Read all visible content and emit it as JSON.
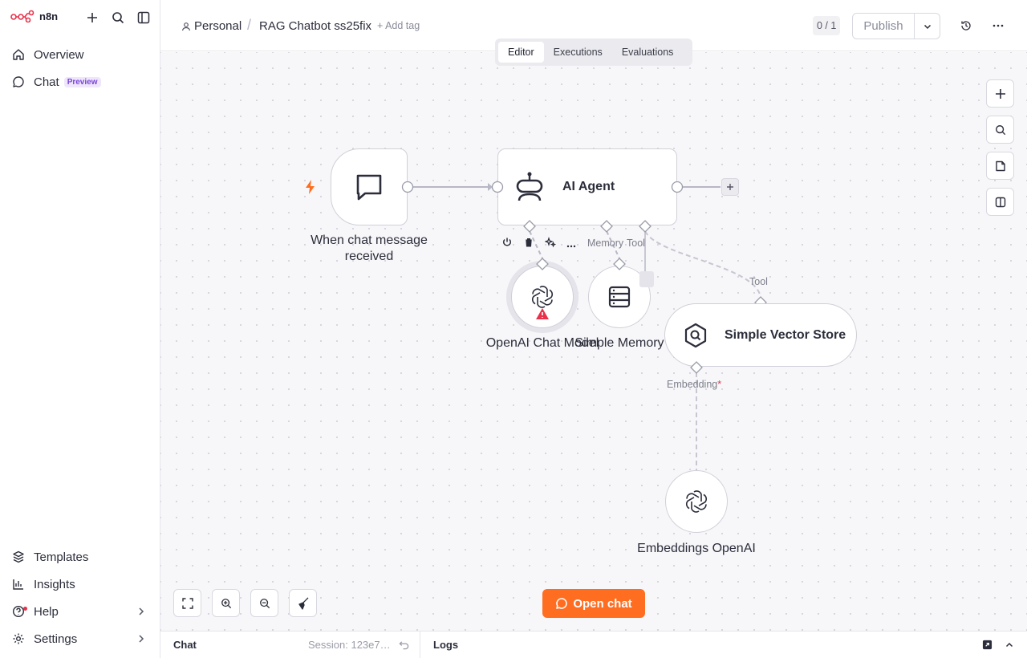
{
  "app": {
    "logo_text": "n8n"
  },
  "sidebar": {
    "top_items": [
      {
        "label": "Overview",
        "icon": "home-icon"
      },
      {
        "label": "Chat",
        "icon": "chat-bubble-icon",
        "badge": "Preview"
      }
    ],
    "bottom_items": [
      {
        "label": "Templates",
        "icon": "templates-icon"
      },
      {
        "label": "Insights",
        "icon": "insights-icon"
      },
      {
        "label": "Help",
        "icon": "help-icon"
      },
      {
        "label": "Settings",
        "icon": "gear-icon"
      }
    ]
  },
  "header": {
    "project": "Personal",
    "workflow_name": "RAG Chatbot ss25fix",
    "add_tag": "+ Add tag",
    "counter": "0 / 1",
    "publish_label": "Publish"
  },
  "tabs": [
    {
      "label": "Editor",
      "active": true
    },
    {
      "label": "Executions",
      "active": false
    },
    {
      "label": "Evaluations",
      "active": false
    }
  ],
  "nodes": {
    "trigger": {
      "label": "When chat message received"
    },
    "agent": {
      "label": "AI Agent"
    },
    "chat_model": {
      "label": "OpenAI Chat Model"
    },
    "memory": {
      "label": "Simple Memory"
    },
    "vector_store": {
      "label": "Simple Vector Store"
    },
    "embeddings": {
      "label": "Embeddings OpenAI"
    }
  },
  "port_labels": {
    "memory": "Memory",
    "tool": "Tool",
    "tool2": "Tool",
    "embedding": "Embedding",
    "required_mark": "*"
  },
  "canvas": {
    "open_chat_label": "Open chat"
  },
  "bottom_panel": {
    "chat_label": "Chat",
    "session_label": "Session: 123e7…",
    "logs_label": "Logs"
  },
  "colors": {
    "accent": "#ff6d20",
    "warning": "#e8314a",
    "preview": "#7a45d6"
  }
}
